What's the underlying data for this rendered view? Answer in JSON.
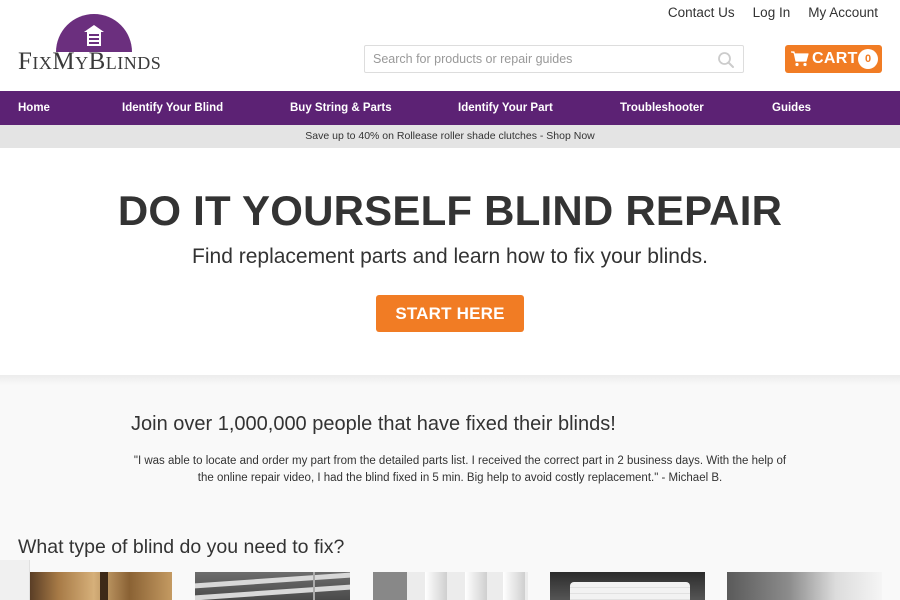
{
  "logo": {
    "text": "FixMyBlinds"
  },
  "toplinks": [
    "Contact Us",
    "Log In",
    "My Account"
  ],
  "search": {
    "placeholder": "Search for products or repair guides",
    "icon": "search-icon"
  },
  "cart": {
    "label": "CART",
    "count": "0",
    "icon": "cart-icon"
  },
  "nav": [
    "Home",
    "Identify Your Blind",
    "Buy String & Parts",
    "Identify Your Part",
    "Troubleshooter",
    "Guides"
  ],
  "promo": "Save up to 40% on Rollease roller shade clutches - Shop Now",
  "hero": {
    "title": "DO IT YOURSELF BLIND REPAIR",
    "subtitle": "Find replacement parts and learn how to fix your blinds.",
    "button": "START HERE"
  },
  "testimonial": {
    "heading": "Join over 1,000,000 people that have fixed their blinds!",
    "quote_line1": "\"I was able to locate and order my part from the detailed parts list. I received the correct part in 2 business days. With the help of",
    "quote_line2": "the online repair video, I had the blind fixed in 5 min. Big help to avoid costly replacement.\"   - Michael B."
  },
  "blind_types": {
    "heading": "What type of blind do you need to fix?"
  },
  "colors": {
    "brand_purple": "#5c2274",
    "accent_orange": "#f17c24"
  }
}
